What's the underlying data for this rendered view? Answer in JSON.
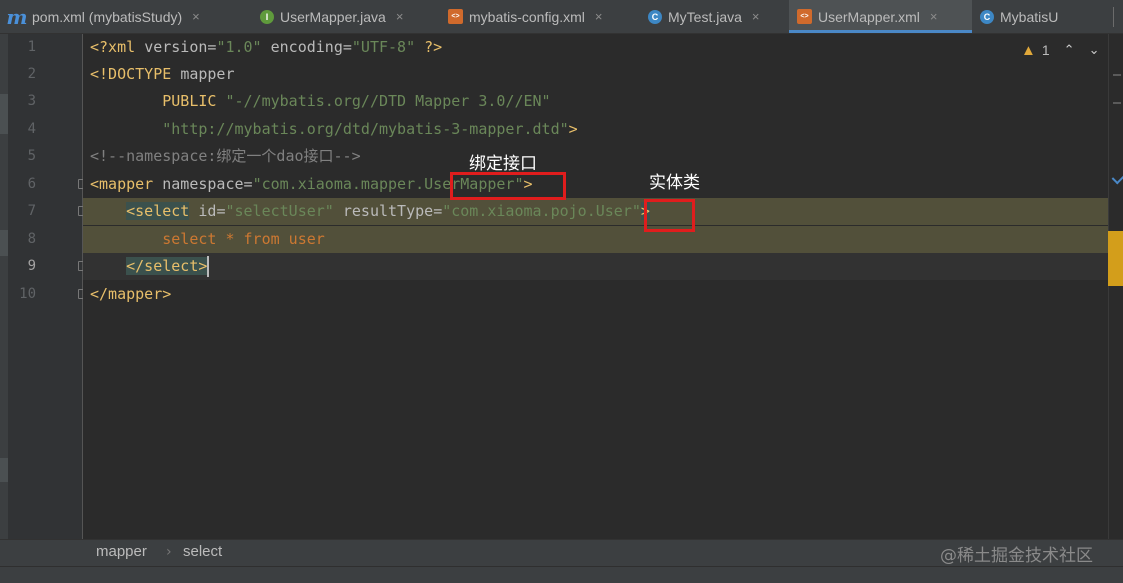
{
  "tabs": [
    {
      "label": "pom.xml (mybatisStudy)",
      "icon": "maven-icon",
      "glyph": "m",
      "active": false
    },
    {
      "label": "UserMapper.java",
      "icon": "interface-icon",
      "glyph": "I",
      "active": false
    },
    {
      "label": "mybatis-config.xml",
      "icon": "xml-file-icon",
      "glyph": "<>",
      "active": false
    },
    {
      "label": "MyTest.java",
      "icon": "class-icon",
      "glyph": "C",
      "active": false
    },
    {
      "label": "UserMapper.xml",
      "icon": "xml-file-icon",
      "glyph": "<>",
      "active": true
    },
    {
      "label": "MybatisU",
      "icon": "class-icon",
      "glyph": "C",
      "active": false
    }
  ],
  "close_glyph": "×",
  "line_numbers": [
    "1",
    "2",
    "3",
    "4",
    "5",
    "6",
    "7",
    "8",
    "9",
    "10"
  ],
  "code": {
    "l1": {
      "a": "<?xml ",
      "b": "version",
      "c": "=",
      "d": "\"1.0\"",
      "e": " ",
      "f": "encoding",
      "g": "=",
      "h": "\"UTF-8\"",
      "i": " ?>"
    },
    "l2": {
      "a": "<!DOCTYPE ",
      "b": "mapper"
    },
    "l3": {
      "a": "        PUBLIC ",
      "b": "\"-//mybatis.org//DTD Mapper 3.0//EN\""
    },
    "l4": {
      "a": "        ",
      "b": "\"http://mybatis.org/dtd/mybatis-3-mapper.dtd\"",
      "c": ">"
    },
    "l5": {
      "a": "<!--namespace:绑定一个dao接口-->"
    },
    "l6": {
      "a": "<mapper",
      "b": " namespace",
      "c": "=",
      "d": "\"com.xiaoma.mapper.UserMapper\"",
      "e": ">"
    },
    "l7": {
      "a": "    ",
      "b": "<select",
      "c": " id",
      "d": "=",
      "e": "\"selectUser\"",
      "f": " resultType",
      "g": "=",
      "h": "\"com.xiaoma.pojo.User\"",
      "i": ">"
    },
    "l8": {
      "a": "        select * from user"
    },
    "l9": {
      "a": "    ",
      "b": "</select>"
    },
    "l10": {
      "a": "</mapper>"
    }
  },
  "annotations": {
    "bind_interface": "绑定接口",
    "entity_class": "实体类"
  },
  "inspection": {
    "warning_count": "1",
    "up": "⌃",
    "down": "⌄"
  },
  "breadcrumb": [
    "mapper",
    "select"
  ],
  "breadcrumb_sep": "›",
  "watermark": "@稀土掘金技术社区",
  "colors": {
    "tag": "#e8bf6a",
    "string": "#6a8759",
    "comment": "#808080",
    "sql_keyword": "#cc7832",
    "highlight": "#52503a",
    "accent": "#4a88c7"
  }
}
